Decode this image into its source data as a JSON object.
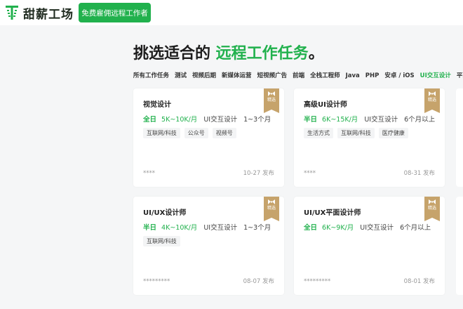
{
  "brand": {
    "name": "甜薪工场",
    "accent": "#21b14d"
  },
  "header": {
    "hire_button": "免费雇佣远程工作者"
  },
  "headline": {
    "prefix": "挑选适合的 ",
    "highlight": "远程工作任务",
    "suffix": "。"
  },
  "tabs": [
    {
      "label": "所有工作任务",
      "active": false
    },
    {
      "label": "测试",
      "active": false
    },
    {
      "label": "视频后期",
      "active": false
    },
    {
      "label": "新媒体运营",
      "active": false
    },
    {
      "label": "短视频广告",
      "active": false
    },
    {
      "label": "前端",
      "active": false
    },
    {
      "label": "全栈工程师",
      "active": false
    },
    {
      "label": "Java",
      "active": false
    },
    {
      "label": "PHP",
      "active": false
    },
    {
      "label": "安卓 / iOS",
      "active": false
    },
    {
      "label": "UI交互设计",
      "active": true
    },
    {
      "label": "平面设计",
      "active": false
    }
  ],
  "badge_label": "精选",
  "cards": [
    {
      "title": "视觉设计",
      "time": "全日",
      "salary": "5K~10K/月",
      "category": "UI交互设计",
      "duration": "1~3个月",
      "tags": [
        "互联网/科技",
        "公众号",
        "视频号"
      ],
      "owner": "****",
      "date": "10-27 发布"
    },
    {
      "title": "高级UI设计师",
      "time": "半日",
      "salary": "6K~15K/月",
      "category": "UI交互设计",
      "duration": "6个月以上",
      "tags": [
        "生活方式",
        "互联网/科技",
        "医疗健康"
      ],
      "owner": "****",
      "date": "08-31 发布"
    },
    {
      "title": "UI/UX设计师",
      "time": "半日",
      "salary": "4K~10K/月",
      "category": "UI交互设计",
      "duration": "1~3个月",
      "tags": [
        "互联网/科技"
      ],
      "owner": "*********",
      "date": "08-07 发布"
    },
    {
      "title": "UI/UX平面设计师",
      "time": "全日",
      "salary": "6K~9K/月",
      "category": "UI交互设计",
      "duration": "6个月以上",
      "tags": [],
      "owner": "*********",
      "date": "08-01 发布"
    }
  ]
}
